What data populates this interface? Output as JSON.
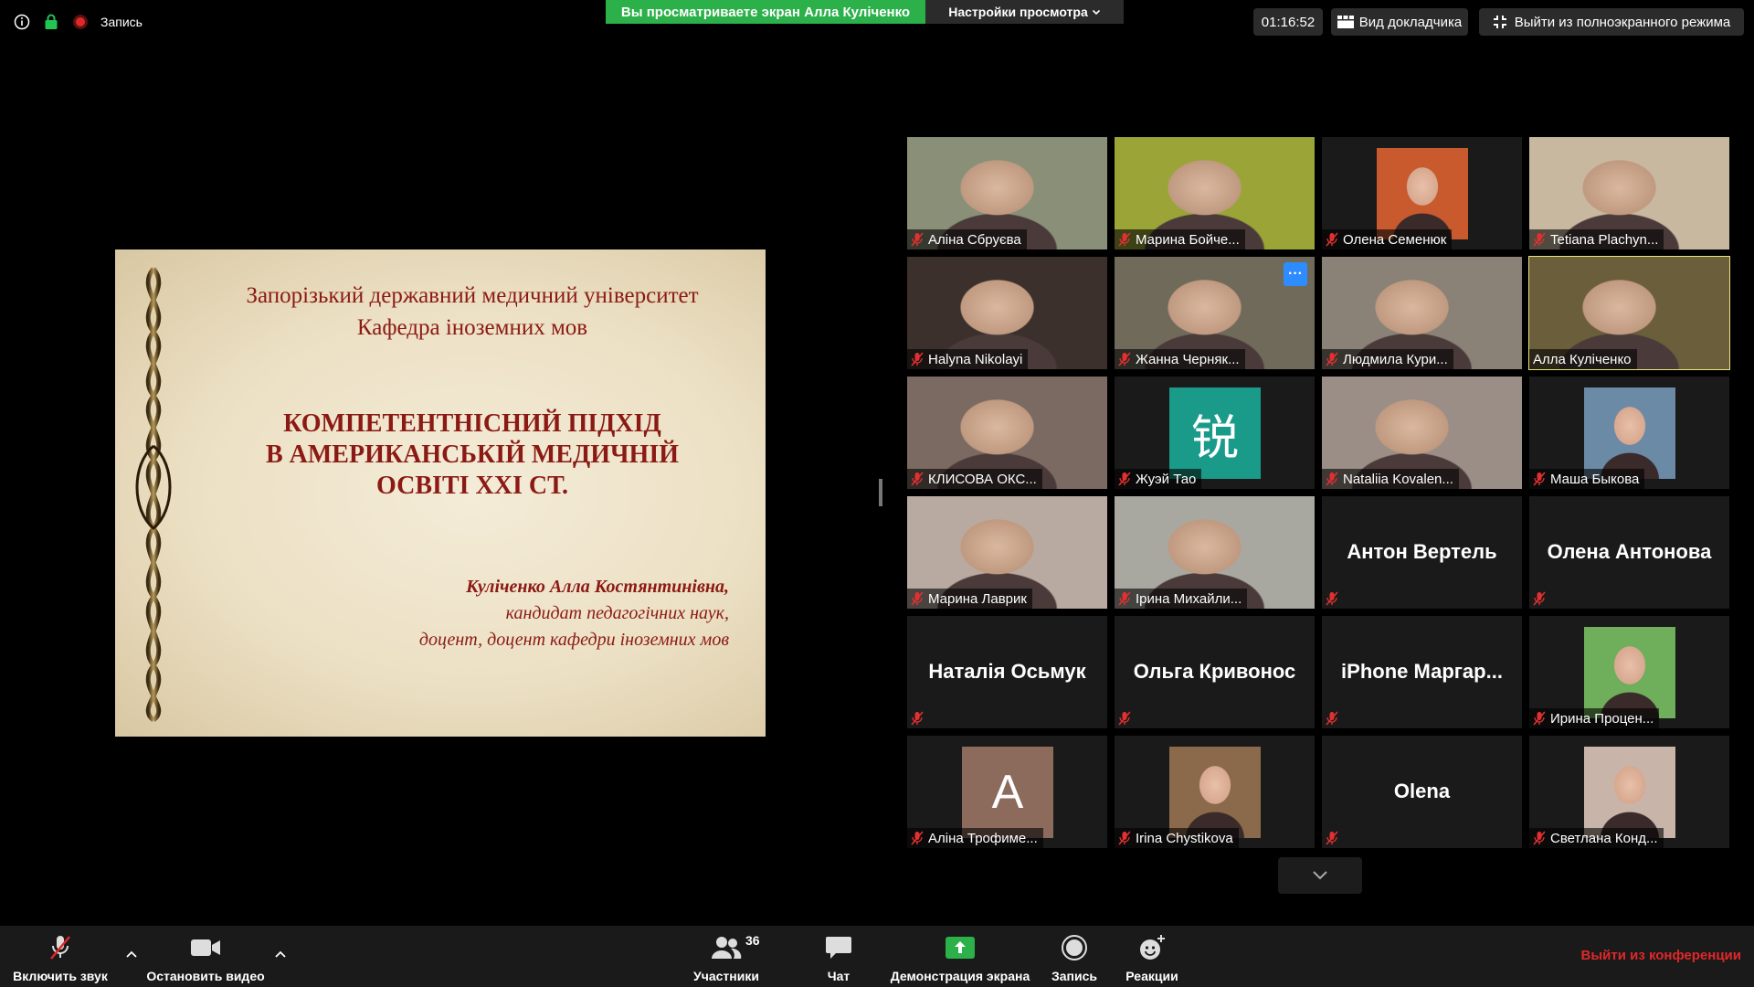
{
  "topbar": {
    "recording_label": "Запись",
    "share_banner": "Вы просматриваете экран Алла Куліченко",
    "view_options": "Настройки просмотра",
    "timer": "01:16:52",
    "speaker_view": "Вид докладчика",
    "exit_fullscreen": "Выйти из полноэкранного режима"
  },
  "slide": {
    "university": "Запорізький державний медичний університет",
    "department": "Кафедра іноземних мов",
    "title_line1": "КОМПЕТЕНТНІСНИЙ ПІДХІД",
    "title_line2": "В АМЕРИКАНСЬКІЙ МЕДИЧНІЙ",
    "title_line3": "ОСВІТІ XXI СТ.",
    "author": "Куліченко Алла Костянтинівна,",
    "degree": "кандидат педагогічних наук,",
    "position": "доцент, доцент кафедри іноземних мов"
  },
  "participants": [
    {
      "name": "Аліна Сбруєва",
      "kind": "video",
      "bg": "#8a8f78"
    },
    {
      "name": "Марина Бойче...",
      "kind": "video",
      "bg": "#9aa437"
    },
    {
      "name": "Олена Семенюк",
      "kind": "photo",
      "bg": "#c85a2e"
    },
    {
      "name": "Tetiana Plachyn...",
      "kind": "video",
      "bg": "#c9b8a0"
    },
    {
      "name": "Halyna Nikolayi",
      "kind": "video",
      "bg": "#3b302c"
    },
    {
      "name": "Жанна Черняк...",
      "kind": "video",
      "bg": "#6f6a5a"
    },
    {
      "name": "Людмила Кури...",
      "kind": "video",
      "bg": "#8a8276"
    },
    {
      "name": "Алла Куліченко",
      "kind": "video",
      "bg": "#6b5e3a"
    },
    {
      "name": "КЛИСОВА ОКС...",
      "kind": "video",
      "bg": "#7b6a62"
    },
    {
      "name": "Жуэй Тао",
      "kind": "avatar-char",
      "bg": "#1a9b8a",
      "char": "锐"
    },
    {
      "name": "Nataliia Kovalen...",
      "kind": "video",
      "bg": "#9a8e86"
    },
    {
      "name": "Маша Быкова",
      "kind": "photo",
      "bg": "#6b8aa6"
    },
    {
      "name": "Марина Лаврик",
      "kind": "video",
      "bg": "#b8aaa0"
    },
    {
      "name": "Ірина Михайли...",
      "kind": "video",
      "bg": "#a8a8a0"
    },
    {
      "name": "Антон Вертель",
      "kind": "name"
    },
    {
      "name": "Олена Антонова",
      "kind": "name"
    },
    {
      "name": "Наталія Осьмук",
      "kind": "name"
    },
    {
      "name": "Ольга Кривонос",
      "kind": "name"
    },
    {
      "name": "iPhone  Маргар...",
      "kind": "name"
    },
    {
      "name": "Ирина  Процен...",
      "kind": "photo",
      "bg": "#6fae5a"
    },
    {
      "name": "Аліна Трофиме...",
      "kind": "avatar-letter",
      "bg": "#8c6a5c",
      "char": "A"
    },
    {
      "name": "Irina Chystikova",
      "kind": "photo",
      "bg": "#8a6a4a"
    },
    {
      "name": "Olena",
      "kind": "name"
    },
    {
      "name": "Светлана Конд...",
      "kind": "photo",
      "bg": "#c8b4a8"
    }
  ],
  "toolbar": {
    "unmute": "Включить звук",
    "stop_video": "Остановить видео",
    "participants": "Участники",
    "participants_count": "36",
    "chat": "Чат",
    "share_screen": "Демонстрация экрана",
    "record": "Запись",
    "reactions": "Реакции",
    "leave": "Выйти из конференции"
  },
  "colors": {
    "share_green": "#2cb04a",
    "leave_red": "#e02828",
    "active_speaker": "#e9e37c",
    "slide_text": "#8b1a14"
  }
}
